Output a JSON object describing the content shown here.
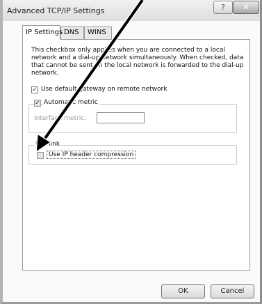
{
  "window": {
    "title": "Advanced TCP/IP Settings",
    "help_glyph": "?",
    "close_glyph": "✕"
  },
  "tabs": [
    {
      "label": "IP Settings",
      "active": true
    },
    {
      "label": "DNS",
      "active": false
    },
    {
      "label": "WINS",
      "active": false
    }
  ],
  "description": [
    "This checkbox only applies when you are connected to a local",
    "network and a dial-up network simultaneously.  When checked, data",
    "that cannot be sent on the local network is forwarded to the dial-up",
    "network."
  ],
  "options": {
    "default_gateway": {
      "label": "Use default gateway on remote network",
      "checked": true
    },
    "automatic_metric": {
      "label": "Automatic metric",
      "checked": true,
      "disabled": true
    },
    "interface_metric": {
      "label": "Interface metric:",
      "value": "",
      "disabled": true
    },
    "ppp_group_label": "PPP link",
    "ip_header_compression": {
      "label": "Use IP header compression",
      "checked": false,
      "disabled": true
    }
  },
  "buttons": {
    "ok": "OK",
    "cancel": "Cancel"
  },
  "check_glyph": "✓"
}
